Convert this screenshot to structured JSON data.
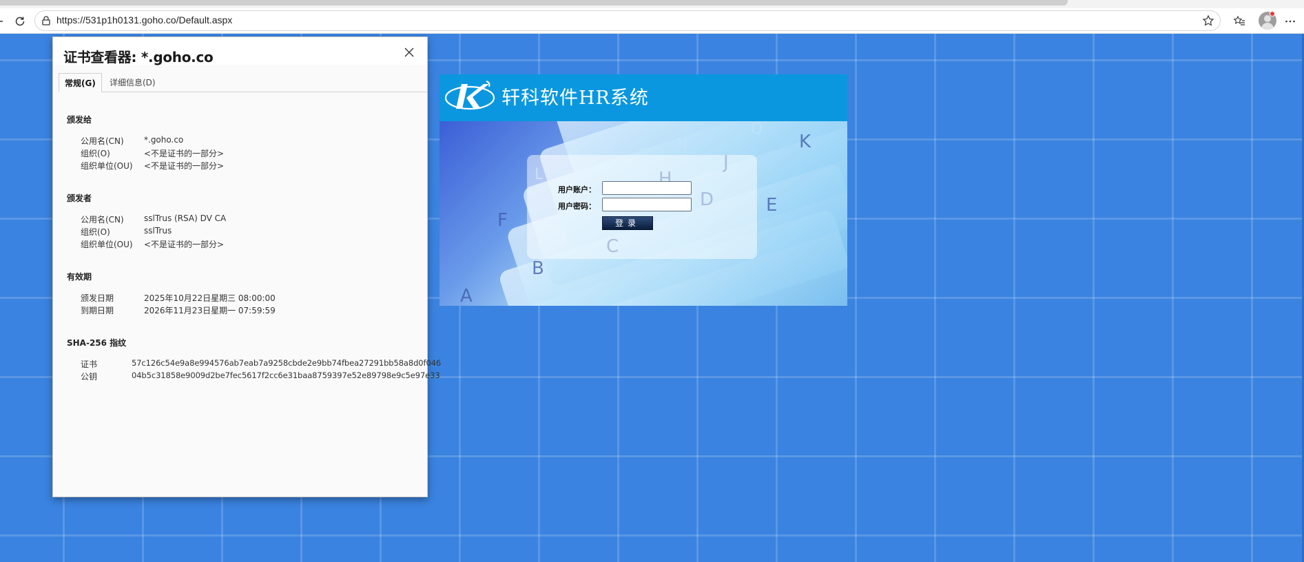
{
  "browser": {
    "url": "https://531p1h0131.goho.co/Default.aspx"
  },
  "dialog": {
    "title": "证书查看器: *.goho.co",
    "tabs": [
      {
        "label": "常规(G)",
        "active": true
      },
      {
        "label": "详细信息(D)",
        "active": false
      }
    ],
    "sections": {
      "issued_to": {
        "title": "颁发给",
        "fields": [
          {
            "label": "公用名(CN)",
            "value": "*.goho.co"
          },
          {
            "label": "组织(O)",
            "value": "<不是证书的一部分>"
          },
          {
            "label": "组织单位(OU)",
            "value": "<不是证书的一部分>"
          }
        ]
      },
      "issued_by": {
        "title": "颁发者",
        "fields": [
          {
            "label": "公用名(CN)",
            "value": "sslTrus (RSA) DV CA"
          },
          {
            "label": "组织(O)",
            "value": "sslTrus"
          },
          {
            "label": "组织单位(OU)",
            "value": "<不是证书的一部分>"
          }
        ]
      },
      "validity": {
        "title": "有效期",
        "fields": [
          {
            "label": "颁发日期",
            "value": "2025年10月22日星期三 08:00:00"
          },
          {
            "label": "到期日期",
            "value": "2026年11月23日星期一 07:59:59"
          }
        ]
      },
      "fingerprints": {
        "title": "SHA-256 指纹",
        "fields": [
          {
            "label": "证书",
            "value": "57c126c54e9a8e994576ab7eab7a9258cbde2e9bb74fbea27291bb58a8d0f046"
          },
          {
            "label": "公钥",
            "value": "04b5c31858e9009d2be7fec5617f2cc6e31baa8759397e52e89798e9c5e97e33"
          }
        ]
      }
    }
  },
  "hr_app": {
    "title": "轩科软件HR系统",
    "username_label": "用户账户：",
    "password_label": "用户密码：",
    "username_value": "",
    "password_value": "",
    "login_button": "登录"
  },
  "colors": {
    "page_background": "#3a83e0",
    "hr_header": "#0b97e0",
    "login_button": "#0a1d3c"
  }
}
